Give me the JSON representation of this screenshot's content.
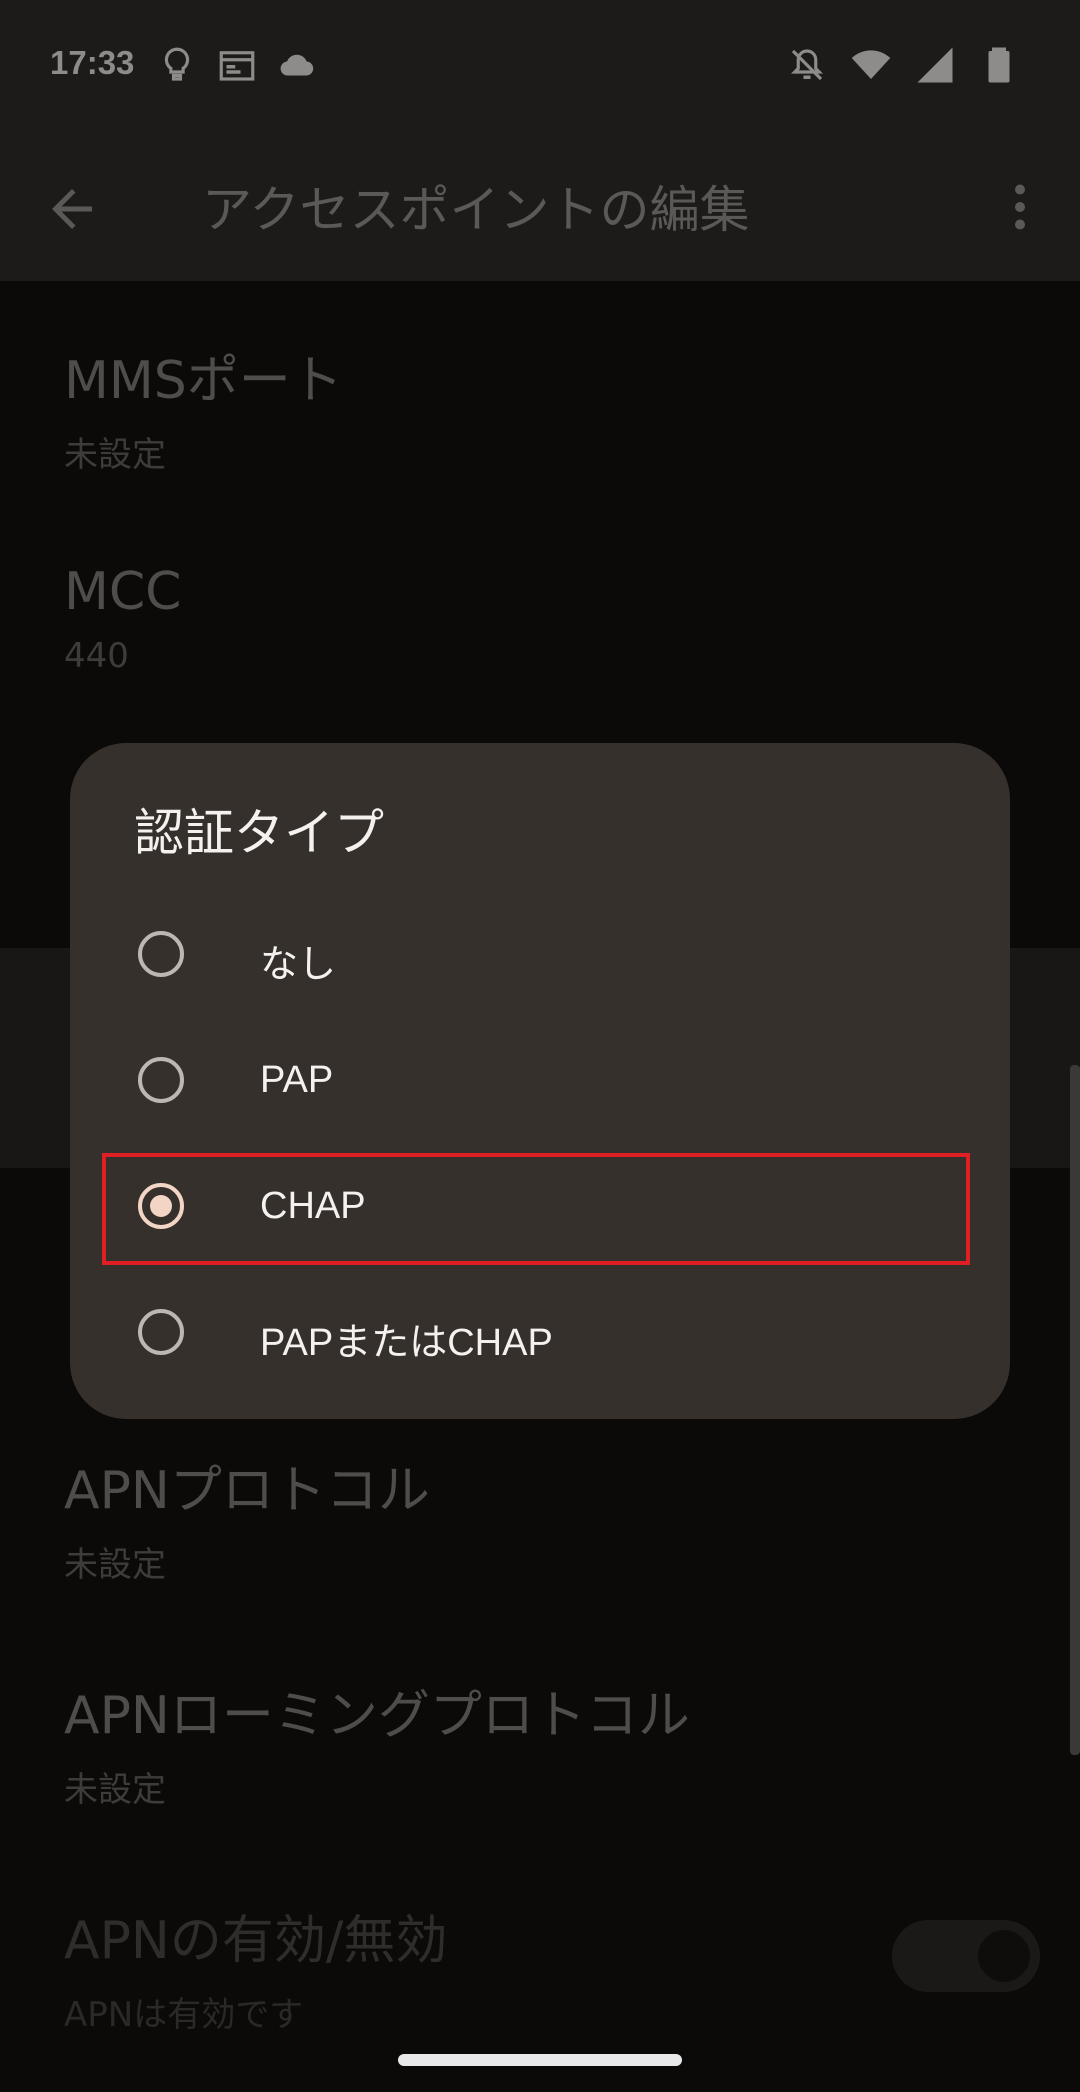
{
  "status_bar": {
    "time": "17:33",
    "left_icons": [
      "lightbulb-icon",
      "calendar-icon",
      "cloud-icon"
    ],
    "right_icons": [
      "notifications-off-icon",
      "wifi-icon",
      "signal-icon",
      "battery-icon"
    ]
  },
  "toolbar": {
    "back_icon": "arrow-back-icon",
    "title": "アクセスポイントの編集",
    "more_icon": "more-vert-icon"
  },
  "preferences": [
    {
      "title": "MMSポート",
      "summary": "未設定"
    },
    {
      "title": "MCC",
      "summary": "440"
    },
    {
      "title": "APNプロトコル",
      "summary": "未設定"
    },
    {
      "title": "APNローミングプロトコル",
      "summary": "未設定"
    },
    {
      "title": "APNの有効/無効",
      "summary": "APNは有効です"
    }
  ],
  "dialog": {
    "title": "認証タイプ",
    "options": [
      {
        "label": "なし",
        "checked": false
      },
      {
        "label": "PAP",
        "checked": false
      },
      {
        "label": "CHAP",
        "checked": true
      },
      {
        "label": "PAPまたはCHAP",
        "checked": false
      }
    ]
  },
  "colors": {
    "dialog_bg": "#35302c",
    "radio_checked": "#f3d5c6",
    "selection_outline": "#e01f25"
  }
}
